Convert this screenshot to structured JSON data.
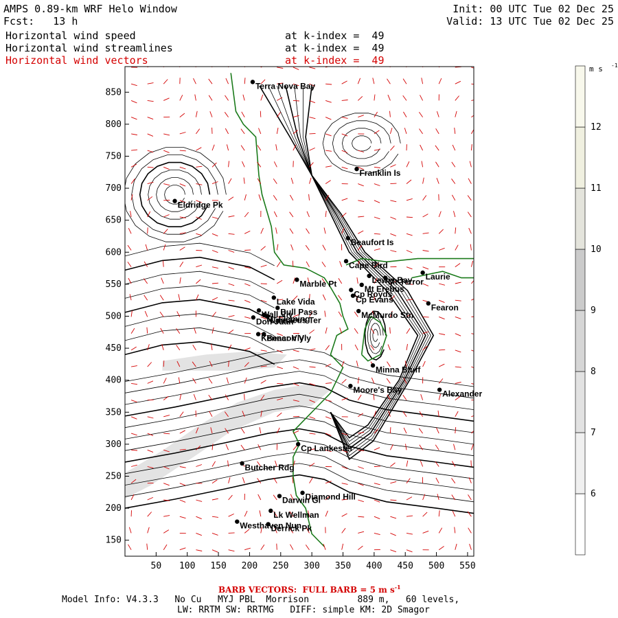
{
  "header": {
    "title": "AMPS 0.89-km WRF Helo Window",
    "forecast": "Fcst:   13 h",
    "init": "Init: 00 UTC Tue 02 Dec 25",
    "valid": "Valid: 13 UTC Tue 02 Dec 25",
    "fields": [
      {
        "label": "Horizontal wind speed",
        "level": "at k-index =  49",
        "color": "#000000"
      },
      {
        "label": "Horizontal wind streamlines",
        "level": "at k-index =  49",
        "color": "#000000"
      },
      {
        "label": "Horizontal wind vectors",
        "level": "at k-index =  49",
        "color": "#d40000"
      }
    ]
  },
  "footer": {
    "barb_note": "BARB VECTORS:  FULL BARB = 5 m s",
    "barb_exp": "-1",
    "model_info": "Model Info: V4.3.3   No Cu   MYJ PBL  Morrison         889 m,   60 levels,",
    "model_info2": "LW: RRTM SW: RRTMG   DIFF: simple KM: 2D Smagor"
  },
  "chart_data": {
    "type": "heatmap",
    "xlim": [
      0,
      560
    ],
    "ylim": [
      125,
      890
    ],
    "x_ticks": [
      50,
      100,
      150,
      200,
      250,
      300,
      350,
      400,
      450,
      500,
      550
    ],
    "y_ticks": [
      150,
      200,
      250,
      300,
      350,
      400,
      450,
      500,
      550,
      600,
      650,
      700,
      750,
      800,
      850
    ],
    "colorbar": {
      "units": "m s",
      "units_exp": "-1",
      "levels": [
        5,
        6,
        7,
        8,
        9,
        10,
        11,
        12,
        13
      ],
      "labels": [
        "6",
        "7",
        "8",
        "9",
        "10",
        "11",
        "12"
      ],
      "colors": [
        "#ffffff",
        "#f0f0f0",
        "#e2e2e2",
        "#d6d6d6",
        "#cbcbcb",
        "#e4e4dc",
        "#f0f0e0",
        "#f8f8ec"
      ]
    },
    "stations": [
      {
        "name": "Terra Nova Bay",
        "x": 205,
        "y": 866
      },
      {
        "name": "Franklin Is",
        "x": 372,
        "y": 730
      },
      {
        "name": "Eldridge Pk",
        "x": 80,
        "y": 680
      },
      {
        "name": "Beaufort Is",
        "x": 358,
        "y": 622
      },
      {
        "name": "Cape Bird",
        "x": 355,
        "y": 586
      },
      {
        "name": "Lewis Bay",
        "x": 392,
        "y": 563
      },
      {
        "name": "Laurie",
        "x": 478,
        "y": 568
      },
      {
        "name": "Mt Terror",
        "x": 418,
        "y": 560
      },
      {
        "name": "Marble Pt",
        "x": 276,
        "y": 557
      },
      {
        "name": "Cp Royds",
        "x": 363,
        "y": 541
      },
      {
        "name": "Mt Erebus",
        "x": 380,
        "y": 549
      },
      {
        "name": "Lake Vida",
        "x": 239,
        "y": 529
      },
      {
        "name": "Cp Evans",
        "x": 366,
        "y": 532
      },
      {
        "name": "Fearon",
        "x": 487,
        "y": 520
      },
      {
        "name": "Wall Vly",
        "x": 215,
        "y": 509
      },
      {
        "name": "Bull Pass",
        "x": 245,
        "y": 513
      },
      {
        "name": "McMurdo Stn",
        "x": 375,
        "y": 508
      },
      {
        "name": "Don Juan",
        "x": 206,
        "y": 498
      },
      {
        "name": "Linnaeus Ter",
        "x": 229,
        "y": 500
      },
      {
        "name": "Mt Fleming",
        "x": 223,
        "y": 502
      },
      {
        "name": "Kennar Vly",
        "x": 214,
        "y": 472
      },
      {
        "name": "Beacon Vly",
        "x": 223,
        "y": 472
      },
      {
        "name": "Minna Bluff",
        "x": 398,
        "y": 423
      },
      {
        "name": "Moore's Bay",
        "x": 362,
        "y": 391
      },
      {
        "name": "Alexander",
        "x": 505,
        "y": 385
      },
      {
        "name": "Cp Lankester",
        "x": 278,
        "y": 300
      },
      {
        "name": "Butcher Rdg",
        "x": 188,
        "y": 270
      },
      {
        "name": "Diamond Hill",
        "x": 285,
        "y": 224
      },
      {
        "name": "Darwin Gl",
        "x": 248,
        "y": 219
      },
      {
        "name": "Lk Wellman",
        "x": 234,
        "y": 196
      },
      {
        "name": "Westhaven Nun",
        "x": 180,
        "y": 179
      },
      {
        "name": "Derrick Pk",
        "x": 230,
        "y": 175
      }
    ]
  }
}
